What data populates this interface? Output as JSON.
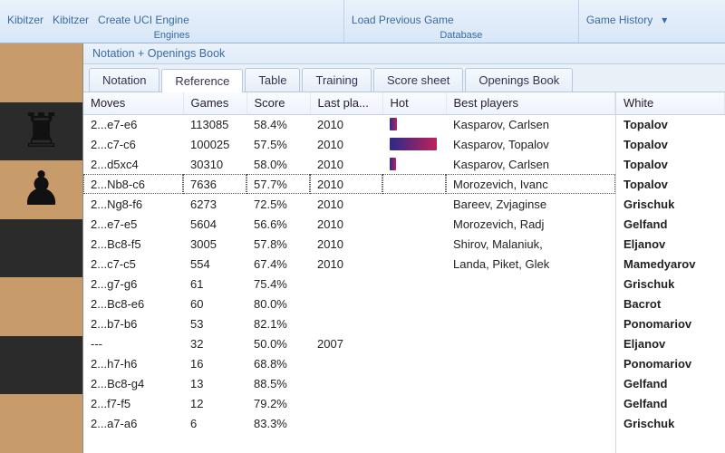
{
  "ribbon": {
    "engines": {
      "label": "Engines",
      "items": [
        "Kibitzer",
        "Kibitzer",
        "Create UCI Engine"
      ]
    },
    "database": {
      "label": "Database",
      "items": [
        "Load Previous Game"
      ]
    },
    "history": {
      "label": "Game History"
    }
  },
  "panel_title": "Notation + Openings Book",
  "tabs": [
    {
      "label": "Notation",
      "active": false
    },
    {
      "label": "Reference",
      "active": true
    },
    {
      "label": "Table",
      "active": false
    },
    {
      "label": "Training",
      "active": false
    },
    {
      "label": "Score sheet",
      "active": false
    },
    {
      "label": "Openings Book",
      "active": false
    }
  ],
  "headers": {
    "moves": "Moves",
    "games": "Games",
    "score": "Score",
    "last": "Last pla...",
    "hot": "Hot",
    "best": "Best players",
    "white": "White"
  },
  "rows": [
    {
      "move": "2...e7-e6",
      "games": "113085",
      "score": "58.4%",
      "last": "2010",
      "hot": 8,
      "best": "Kasparov, Carlsen",
      "white": "Topalov"
    },
    {
      "move": "2...c7-c6",
      "games": "100025",
      "score": "57.5%",
      "last": "2010",
      "hot": 52,
      "best": "Kasparov, Topalov",
      "white": "Topalov"
    },
    {
      "move": "2...d5xc4",
      "games": "30310",
      "score": "58.0%",
      "last": "2010",
      "hot": 7,
      "best": "Kasparov, Carlsen",
      "white": "Topalov"
    },
    {
      "move": "2...Nb8-c6",
      "games": "7636",
      "score": "57.7%",
      "last": "2010",
      "hot": 0,
      "best": "Morozevich, Ivanc",
      "white": "Topalov",
      "selected": true
    },
    {
      "move": "2...Ng8-f6",
      "games": "6273",
      "score": "72.5%",
      "last": "2010",
      "hot": 0,
      "best": "Bareev, Zvjaginse",
      "white": "Grischuk"
    },
    {
      "move": "2...e7-e5",
      "games": "5604",
      "score": "56.6%",
      "last": "2010",
      "hot": 0,
      "best": "Morozevich, Radj",
      "white": "Gelfand"
    },
    {
      "move": "2...Bc8-f5",
      "games": "3005",
      "score": "57.8%",
      "last": "2010",
      "hot": 0,
      "best": "Shirov, Malaniuk,",
      "white": "Eljanov"
    },
    {
      "move": "2...c7-c5",
      "games": "554",
      "score": "67.4%",
      "last": "2010",
      "hot": 0,
      "best": "Landa, Piket, Glek",
      "white": "Mamedyarov"
    },
    {
      "move": "2...g7-g6",
      "games": "61",
      "score": "75.4%",
      "last": "",
      "hot": 0,
      "best": "",
      "white": "Grischuk"
    },
    {
      "move": "2...Bc8-e6",
      "games": "60",
      "score": "80.0%",
      "last": "",
      "hot": 0,
      "best": "",
      "white": "Bacrot"
    },
    {
      "move": "2...b7-b6",
      "games": "53",
      "score": "82.1%",
      "last": "",
      "hot": 0,
      "best": "",
      "white": "Ponomariov"
    },
    {
      "move": "---",
      "games": "32",
      "score": "50.0%",
      "last": "2007",
      "hot": 0,
      "best": "",
      "white": "Eljanov"
    },
    {
      "move": "2...h7-h6",
      "games": "16",
      "score": "68.8%",
      "last": "",
      "hot": 0,
      "best": "",
      "white": "Ponomariov"
    },
    {
      "move": "2...Bc8-g4",
      "games": "13",
      "score": "88.5%",
      "last": "",
      "hot": 0,
      "best": "",
      "white": "Gelfand"
    },
    {
      "move": "2...f7-f5",
      "games": "12",
      "score": "79.2%",
      "last": "",
      "hot": 0,
      "best": "",
      "white": "Gelfand"
    },
    {
      "move": "2...a7-a6",
      "games": "6",
      "score": "83.3%",
      "last": "",
      "hot": 0,
      "best": "",
      "white": "Grischuk"
    }
  ]
}
